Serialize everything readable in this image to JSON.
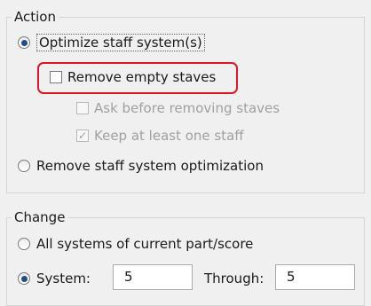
{
  "action": {
    "title": "Action",
    "optimize_label": "Optimize staff system(s)",
    "optimize_selected": true,
    "remove_empty_label": "Remove empty staves",
    "remove_empty_checked": false,
    "ask_before_label": "Ask before removing staves",
    "ask_before_checked": false,
    "keep_one_label": "Keep at least one staff",
    "keep_one_checked": true,
    "remove_optimization_label": "Remove staff system optimization",
    "remove_optimization_selected": false
  },
  "change": {
    "title": "Change",
    "all_systems_label": "All systems of current part/score",
    "all_systems_selected": false,
    "system_label": "System:",
    "system_selected": true,
    "system_value": "5",
    "through_label": "Through:",
    "through_value": "5"
  },
  "highlight_color": "#e0142a"
}
